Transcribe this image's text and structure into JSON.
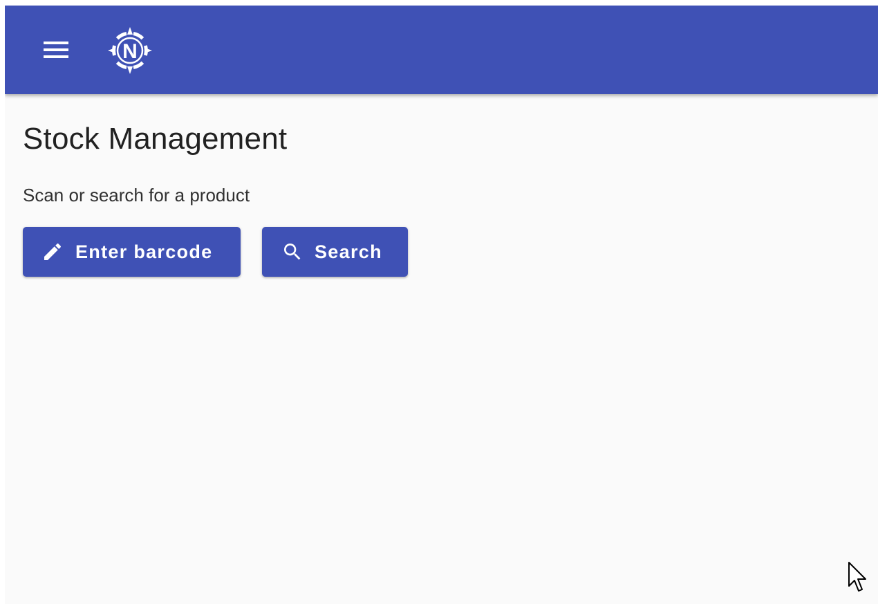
{
  "colors": {
    "primary": "#3f51b5",
    "background": "#fafafa",
    "title_text": "#212121",
    "on_primary": "#ffffff"
  },
  "toolbar": {
    "menu_icon": "hamburger-menu-icon",
    "logo_icon": "compass-n-logo-icon",
    "logo_letter": "N"
  },
  "page": {
    "title": "Stock Management",
    "subtitle": "Scan or search for a product"
  },
  "actions": {
    "enter_barcode": {
      "label": "Enter barcode",
      "icon": "pencil-icon"
    },
    "search": {
      "label": "Search",
      "icon": "search-icon"
    }
  }
}
